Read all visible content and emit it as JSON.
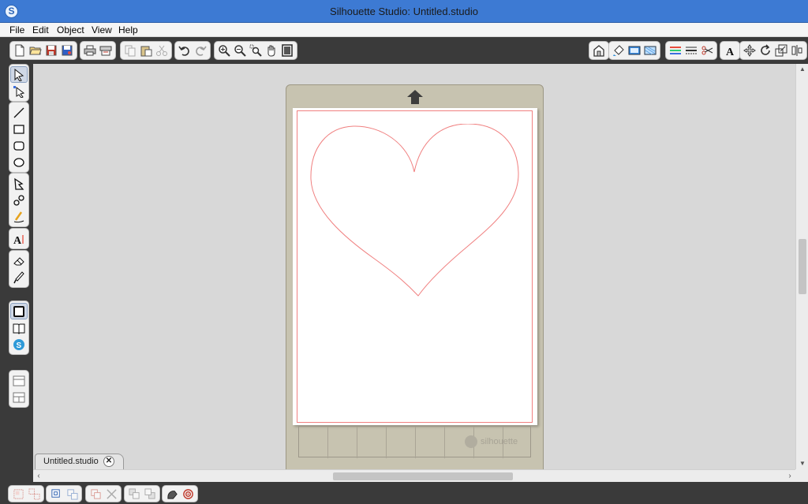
{
  "window": {
    "title": "Silhouette Studio: Untitled.studio",
    "app_icon_glyph": "S"
  },
  "menu": {
    "items": [
      "File",
      "Edit",
      "Object",
      "View",
      "Help"
    ]
  },
  "document": {
    "tab_label": "Untitled.studio",
    "close_glyph": "✕"
  },
  "mat": {
    "brand": "silhouette"
  },
  "colors": {
    "cut_line": "#f08080",
    "title_bar": "#3d7ad3",
    "toolbar_bg": "#3a3a3a",
    "canvas_bg": "#d8d8d8"
  },
  "icons": {
    "top_toolbar": [
      "new-document-icon",
      "open-folder-icon",
      "save-icon",
      "save-to-library-icon",
      "print-icon",
      "send-to-cutter-icon",
      "copy-icon",
      "paste-icon",
      "cut-icon",
      "undo-icon",
      "redo-icon",
      "zoom-in-icon",
      "zoom-out-icon",
      "zoom-select-icon",
      "pan-icon",
      "fit-to-page-icon",
      "page-setup-icon",
      "fill-color-icon",
      "fill-pattern-icon",
      "fill-gradient-icon",
      "line-color-icon",
      "line-style-icon",
      "cut-settings-icon",
      "text-style-icon",
      "transform-icon",
      "rotate-icon",
      "scale-icon",
      "align-icon"
    ],
    "left_toolbar": [
      "select-icon",
      "point-edit-icon",
      "line-icon",
      "rectangle-icon",
      "rounded-rectangle-icon",
      "ellipse-icon",
      "polygon-icon",
      "curve-icon",
      "freehand-icon",
      "text-icon",
      "eraser-icon",
      "knife-icon",
      "design-page-icon",
      "library-icon",
      "store-icon",
      "panel-top-icon",
      "panel-split-icon"
    ],
    "bottom_toolbar": [
      "group-icon",
      "ungroup-icon",
      "compound-path-icon",
      "release-compound-icon",
      "duplicate-icon",
      "delete-icon",
      "bring-forward-icon",
      "send-backward-icon",
      "trace-icon",
      "registration-marks-icon"
    ]
  }
}
